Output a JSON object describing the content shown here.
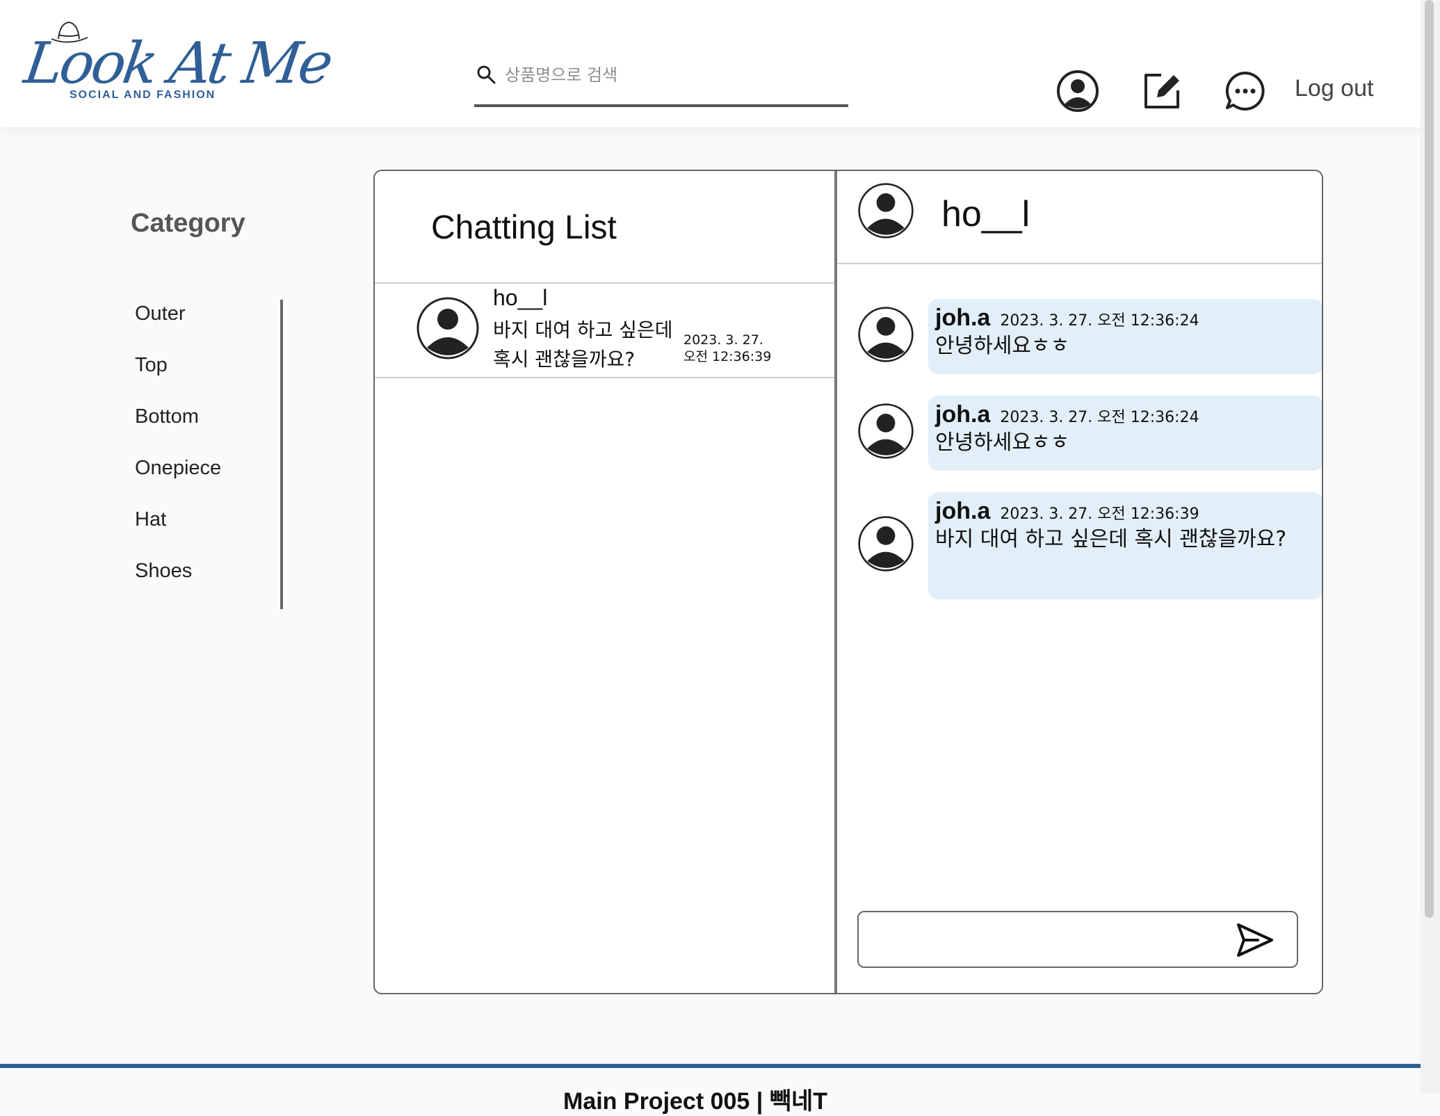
{
  "header": {
    "logo_text": "Look At Me",
    "logo_tagline": "SOCIAL AND FASHION",
    "search_placeholder": "상품명으로 검색",
    "icons": [
      "profile-icon",
      "write-post-icon",
      "chat-icon"
    ],
    "logout_label": "Log out"
  },
  "sidebar": {
    "title": "Category",
    "items": [
      {
        "label": "Outer"
      },
      {
        "label": "Top"
      },
      {
        "label": "Bottom"
      },
      {
        "label": "Onepiece"
      },
      {
        "label": "Hat"
      },
      {
        "label": "Shoes"
      }
    ]
  },
  "chat_list": {
    "title": "Chatting List",
    "items": [
      {
        "name": "ho__l",
        "last_message": "바지 대여 하고 싶은데 혹시 괜찮을까요?",
        "date": "2023. 3. 27.",
        "time": "오전 12:36:39"
      }
    ]
  },
  "chat_room": {
    "partner_name": "ho__l",
    "messages": [
      {
        "sender": "joh.a",
        "timestamp": "2023. 3. 27. 오전 12:36:24",
        "text": "안녕하세요ㅎㅎ"
      },
      {
        "sender": "joh.a",
        "timestamp": "2023. 3. 27. 오전 12:36:24",
        "text": "안녕하세요ㅎㅎ"
      },
      {
        "sender": "joh.a",
        "timestamp": "2023. 3. 27. 오전 12:36:39",
        "text": "바지 대여 하고 싶은데 혹시 괜찮을까요?"
      }
    ],
    "input_value": ""
  },
  "footer": {
    "text": "Main Project 005 | 빽네T"
  },
  "colors": {
    "brand": "#2f5f96",
    "bubble": "#e2eef8",
    "border": "#666666"
  }
}
